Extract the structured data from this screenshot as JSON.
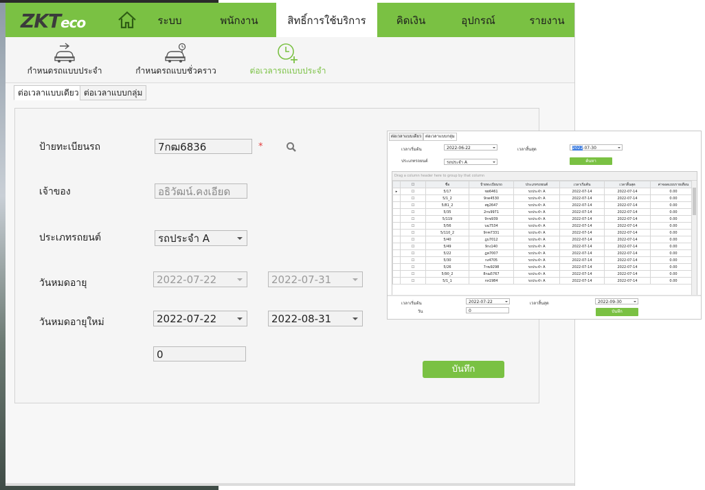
{
  "brand": {
    "logo_main": "ZKT",
    "logo_sub": "eco"
  },
  "nav": {
    "items": [
      {
        "label": "ระบบ"
      },
      {
        "label": "พนักงาน"
      },
      {
        "label": "สิทธิ์การใช้บริการ"
      },
      {
        "label": "คิดเงิน"
      },
      {
        "label": "อุปกรณ์"
      },
      {
        "label": "รายงาน"
      }
    ],
    "active": "สิทธิ์การใช้บริการ"
  },
  "subnav": {
    "items": [
      {
        "label": "กำหนดรถแบบประจำ",
        "icon": "car-arrow-icon"
      },
      {
        "label": "กำหนดรถแบบชั่วคราว",
        "icon": "car-clock-icon"
      },
      {
        "label": "ต่อเวลารถแบบประจำ",
        "icon": "clock-plus-icon"
      }
    ],
    "active": "ต่อเวลารถแบบประจำ"
  },
  "tabs": [
    {
      "label": "ต่อเวลาแบบเดียว"
    },
    {
      "label": "ต่อเวลาแบบกลุ่ม"
    }
  ],
  "form": {
    "plate_label": "ป้ายทะเบียนรถ",
    "plate_value": "7กฒ6836",
    "required_mark": "*",
    "owner_label": "เจ้าของ",
    "owner_value": "อธิวัฒน์.คงเอียด",
    "vehicle_type_label": "ประเภทรถยนต์",
    "vehicle_type_value": "รถประจำ A",
    "expiry_label": "วันหมดอายุ",
    "expiry_start": "2022-07-22",
    "expiry_end": "2022-07-31",
    "new_expiry_label": "วันหมดอายุใหม่",
    "new_expiry_start": "2022-07-22",
    "new_expiry_end": "2022-08-31",
    "amount_value": "0",
    "save_label": "บันทึก"
  },
  "inset": {
    "tabs": [
      "ต่อเวลาแบบเดียว",
      "ต่อเวลาแบบกลุ่ม"
    ],
    "start_label": "เวลาเริ่มต้น",
    "start_value": "2022-06-22",
    "end_label": "เวลาสิ้นสุด",
    "end_value_highlight": "2022",
    "end_value_rest": "-07-30",
    "type_label": "ประเภทรถยนต์",
    "type_value": "รถประจำ A",
    "search_label": "ค้นหา",
    "group_hint": "Drag a column header here to group by that column",
    "columns": [
      "",
      "ชื่อ",
      "ป้ายทะเบียนรถ",
      "ประเภทรถยนต์",
      "เวลาเริ่มต้น",
      "เวลาสิ้นสุด",
      "ค่าจอดแบบรายเดือน"
    ],
    "rows": [
      [
        "5/17",
        "ชฮ6461",
        "รถประจำ A",
        "2022-07-14",
        "2022-07-14",
        "0.00"
      ],
      [
        "5/1_2",
        "9กต4530",
        "รถประจำ A",
        "2022-07-14",
        "2022-07-14",
        "0.00"
      ],
      [
        "5/81_2",
        "ศฐ2647",
        "รถประจำ A",
        "2022-07-14",
        "2022-07-14",
        "0.00"
      ],
      [
        "5/35",
        "2กบ9971",
        "รถประจำ A",
        "2022-07-14",
        "2022-07-14",
        "0.00"
      ],
      [
        "5/119",
        "9กข939",
        "รถประจำ A",
        "2022-07-14",
        "2022-07-14",
        "0.00"
      ],
      [
        "5/56",
        "บฉ7534",
        "รถประจำ A",
        "2022-07-14",
        "2022-07-14",
        "0.00"
      ],
      [
        "5/110_2",
        "9กฑ7331",
        "รถประจำ A",
        "2022-07-14",
        "2022-07-14",
        "0.00"
      ],
      [
        "5/40",
        "ฎบ7012",
        "รถประจำ A",
        "2022-07-14",
        "2022-07-14",
        "0.00"
      ],
      [
        "5/49",
        "9กง140",
        "รถประจำ A",
        "2022-07-14",
        "2022-07-14",
        "0.00"
      ],
      [
        "5/22",
        "ฎพ7007",
        "รถประจำ A",
        "2022-07-14",
        "2022-07-14",
        "0.00"
      ],
      [
        "5/30",
        "กง4705",
        "รถประจำ A",
        "2022-07-14",
        "2022-07-14",
        "0.00"
      ],
      [
        "5/26",
        "7กฆ9298",
        "รถประจำ A",
        "2022-07-14",
        "2022-07-14",
        "0.00"
      ],
      [
        "5/90_2",
        "8กฌ5767",
        "รถประจำ A",
        "2022-07-14",
        "2022-07-14",
        "0.00"
      ],
      [
        "5/1_1",
        "กท1984",
        "รถประจำ A",
        "2022-07-14",
        "2022-07-14",
        "0.00"
      ]
    ],
    "bottom_start_label": "เวลาเริ่มต้น",
    "bottom_start_value": "2022-07-22",
    "bottom_end_label": "เวลาสิ้นสุด",
    "bottom_end_value": "2022-09-30",
    "days_label": "วัน",
    "days_value": "0",
    "save_label": "บันทึก"
  },
  "colors": {
    "accent": "#7ac143",
    "required": "#e23b3b"
  }
}
